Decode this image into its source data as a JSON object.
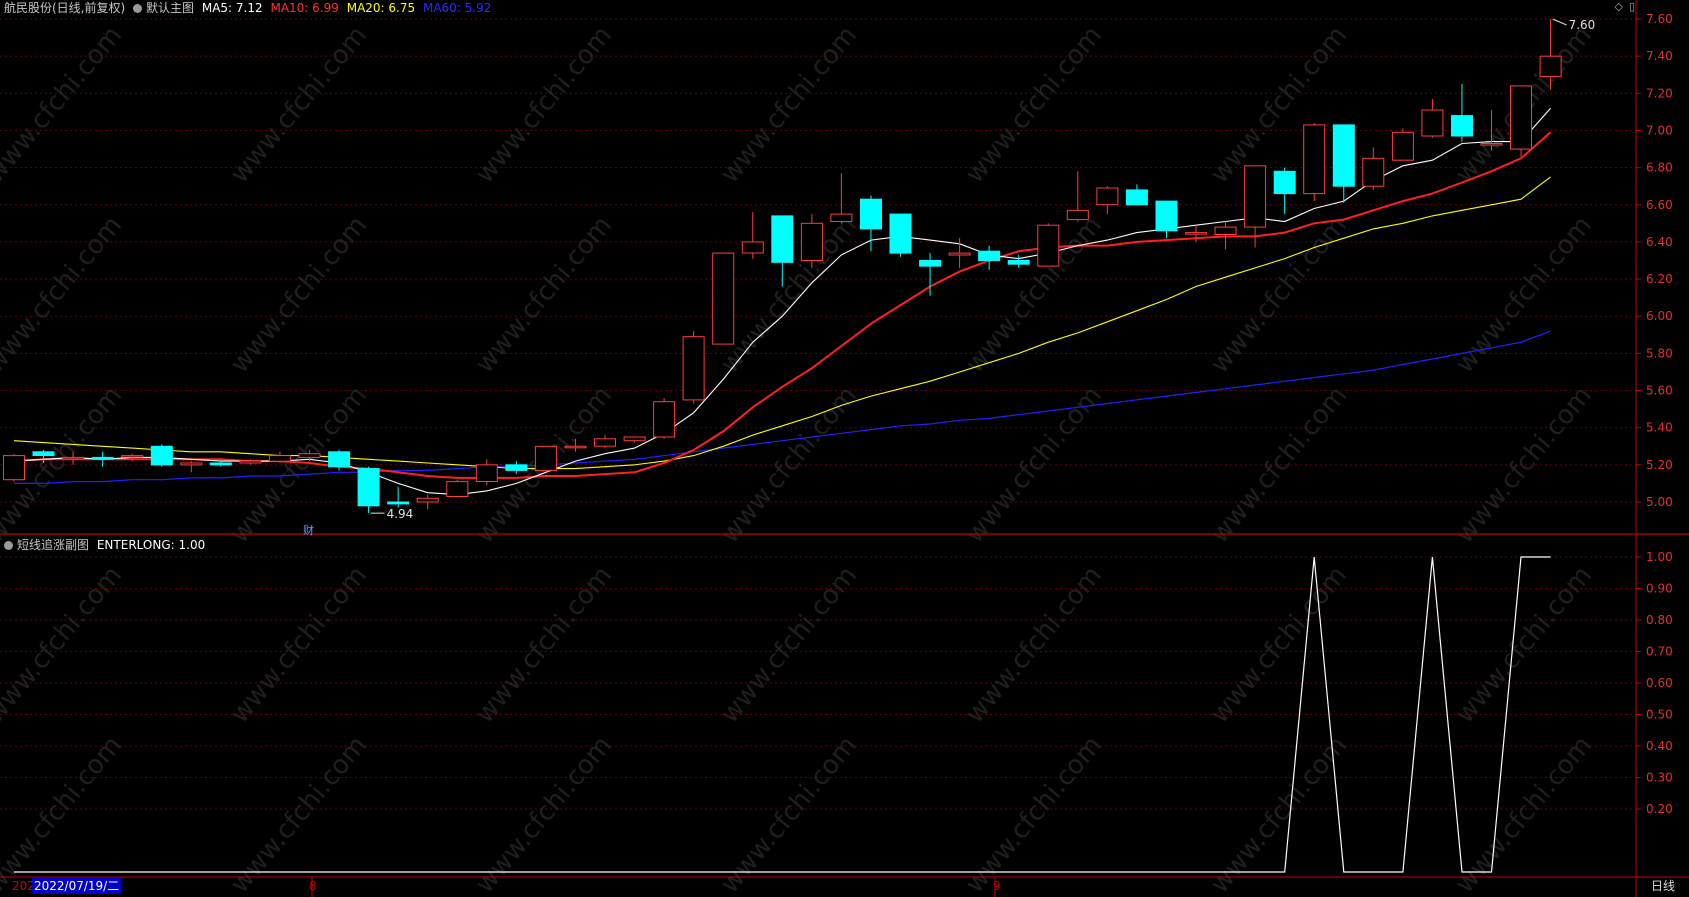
{
  "header": {
    "stock_name": "航民股份(日线,前复权)",
    "main_indicator": "默认主图",
    "ma5": "MA5: 7.12",
    "ma10": "MA10: 6.99",
    "ma20": "MA20: 6.75",
    "ma60": "MA60: 5.92",
    "ma_colors": {
      "ma5": "#ffffff",
      "ma10": "#ff2020",
      "ma20": "#ffff00",
      "ma60": "#2020ff"
    }
  },
  "sub_header": {
    "name": "短线追涨副图",
    "value": "ENTERLONG: 1.00"
  },
  "corner_icons": [
    "diamond-icon",
    "window-icon"
  ],
  "x_axis": {
    "year_stub": "202",
    "date_badge": "2022/07/19/二",
    "tick_8": "8",
    "tick_9": "9"
  },
  "period_label": "日线",
  "annotations": {
    "high_label": "7.60",
    "low_label": "4.94",
    "cai_marker": "财"
  },
  "watermark": "www.cfchi.com",
  "chart_data": [
    {
      "type": "candlestick",
      "y_ticks": [
        "7.60",
        "7.40",
        "7.20",
        "7.00",
        "6.80",
        "6.60",
        "6.40",
        "6.20",
        "6.00",
        "5.80",
        "5.60",
        "5.40",
        "5.20",
        "5.00"
      ],
      "ylim": [
        4.8,
        7.72
      ],
      "colors": {
        "up": "#ff3c3c",
        "down": "#00ffff",
        "grid": "#7a0000",
        "axis": "#c00000"
      },
      "candles": [
        {
          "o": 5.12,
          "h": 5.26,
          "l": 5.11,
          "c": 5.25
        },
        {
          "o": 5.27,
          "h": 5.28,
          "l": 5.21,
          "c": 5.25
        },
        {
          "o": 5.24,
          "h": 5.27,
          "l": 5.2,
          "c": 5.24
        },
        {
          "o": 5.24,
          "h": 5.27,
          "l": 5.19,
          "c": 5.23
        },
        {
          "o": 5.25,
          "h": 5.26,
          "l": 5.22,
          "c": 5.25
        },
        {
          "o": 5.3,
          "h": 5.31,
          "l": 5.19,
          "c": 5.2
        },
        {
          "o": 5.2,
          "h": 5.22,
          "l": 5.16,
          "c": 5.21
        },
        {
          "o": 5.21,
          "h": 5.22,
          "l": 5.19,
          "c": 5.2
        },
        {
          "o": 5.21,
          "h": 5.23,
          "l": 5.2,
          "c": 5.22
        },
        {
          "o": 5.22,
          "h": 5.27,
          "l": 5.21,
          "c": 5.25
        },
        {
          "o": 5.24,
          "h": 5.28,
          "l": 5.22,
          "c": 5.26
        },
        {
          "o": 5.27,
          "h": 5.28,
          "l": 5.17,
          "c": 5.19
        },
        {
          "o": 5.18,
          "h": 5.19,
          "l": 4.94,
          "c": 4.98
        },
        {
          "o": 5.0,
          "h": 5.08,
          "l": 4.97,
          "c": 4.99
        },
        {
          "o": 5.0,
          "h": 5.04,
          "l": 4.96,
          "c": 5.02
        },
        {
          "o": 5.03,
          "h": 5.12,
          "l": 5.03,
          "c": 5.11
        },
        {
          "o": 5.11,
          "h": 5.23,
          "l": 5.09,
          "c": 5.2
        },
        {
          "o": 5.2,
          "h": 5.22,
          "l": 5.15,
          "c": 5.17
        },
        {
          "o": 5.17,
          "h": 5.3,
          "l": 5.16,
          "c": 5.3
        },
        {
          "o": 5.3,
          "h": 5.34,
          "l": 5.27,
          "c": 5.3
        },
        {
          "o": 5.3,
          "h": 5.36,
          "l": 5.29,
          "c": 5.34
        },
        {
          "o": 5.33,
          "h": 5.35,
          "l": 5.32,
          "c": 5.35
        },
        {
          "o": 5.35,
          "h": 5.56,
          "l": 5.34,
          "c": 5.54
        },
        {
          "o": 5.55,
          "h": 5.92,
          "l": 5.53,
          "c": 5.89
        },
        {
          "o": 5.85,
          "h": 6.34,
          "l": 5.85,
          "c": 6.34
        },
        {
          "o": 6.34,
          "h": 6.56,
          "l": 6.31,
          "c": 6.4
        },
        {
          "o": 6.54,
          "h": 6.54,
          "l": 6.16,
          "c": 6.29
        },
        {
          "o": 6.3,
          "h": 6.55,
          "l": 6.26,
          "c": 6.5
        },
        {
          "o": 6.51,
          "h": 6.77,
          "l": 6.5,
          "c": 6.55
        },
        {
          "o": 6.63,
          "h": 6.65,
          "l": 6.35,
          "c": 6.47
        },
        {
          "o": 6.55,
          "h": 6.55,
          "l": 6.32,
          "c": 6.34
        },
        {
          "o": 6.3,
          "h": 6.34,
          "l": 6.11,
          "c": 6.27
        },
        {
          "o": 6.33,
          "h": 6.42,
          "l": 6.26,
          "c": 6.34
        },
        {
          "o": 6.35,
          "h": 6.38,
          "l": 6.25,
          "c": 6.3
        },
        {
          "o": 6.3,
          "h": 6.33,
          "l": 6.26,
          "c": 6.28
        },
        {
          "o": 6.27,
          "h": 6.5,
          "l": 6.27,
          "c": 6.49
        },
        {
          "o": 6.52,
          "h": 6.78,
          "l": 6.51,
          "c": 6.57
        },
        {
          "o": 6.6,
          "h": 6.7,
          "l": 6.55,
          "c": 6.69
        },
        {
          "o": 6.68,
          "h": 6.71,
          "l": 6.6,
          "c": 6.6
        },
        {
          "o": 6.62,
          "h": 6.62,
          "l": 6.42,
          "c": 6.46
        },
        {
          "o": 6.45,
          "h": 6.49,
          "l": 6.4,
          "c": 6.45
        },
        {
          "o": 6.44,
          "h": 6.51,
          "l": 6.36,
          "c": 6.48
        },
        {
          "o": 6.48,
          "h": 6.81,
          "l": 6.37,
          "c": 6.81
        },
        {
          "o": 6.78,
          "h": 6.8,
          "l": 6.55,
          "c": 6.66
        },
        {
          "o": 6.66,
          "h": 7.04,
          "l": 6.62,
          "c": 7.03
        },
        {
          "o": 7.03,
          "h": 7.03,
          "l": 6.61,
          "c": 6.7
        },
        {
          "o": 6.7,
          "h": 6.91,
          "l": 6.68,
          "c": 6.85
        },
        {
          "o": 6.84,
          "h": 7.01,
          "l": 6.84,
          "c": 6.99
        },
        {
          "o": 6.97,
          "h": 7.17,
          "l": 6.96,
          "c": 7.11
        },
        {
          "o": 7.08,
          "h": 7.25,
          "l": 6.94,
          "c": 6.97
        },
        {
          "o": 6.93,
          "h": 7.11,
          "l": 6.89,
          "c": 6.93
        },
        {
          "o": 6.9,
          "h": 7.24,
          "l": 6.86,
          "c": 7.24
        },
        {
          "o": 7.29,
          "h": 7.6,
          "l": 7.22,
          "c": 7.4
        }
      ],
      "ma5": [
        5.22,
        5.23,
        5.24,
        5.23,
        5.24,
        5.24,
        5.23,
        5.22,
        5.22,
        5.22,
        5.23,
        5.21,
        5.16,
        5.1,
        5.05,
        5.04,
        5.06,
        5.1,
        5.16,
        5.22,
        5.26,
        5.29,
        5.37,
        5.48,
        5.66,
        5.86,
        6.0,
        6.18,
        6.33,
        6.41,
        6.43,
        6.41,
        6.39,
        6.33,
        6.31,
        6.34,
        6.38,
        6.41,
        6.45,
        6.47,
        6.49,
        6.51,
        6.53,
        6.51,
        6.58,
        6.62,
        6.73,
        6.81,
        6.84,
        6.93,
        6.94,
        6.94,
        7.12
      ],
      "ma10": [
        5.22,
        5.23,
        5.23,
        5.23,
        5.23,
        5.23,
        5.23,
        5.23,
        5.22,
        5.22,
        5.21,
        5.19,
        5.18,
        5.16,
        5.14,
        5.13,
        5.13,
        5.13,
        5.14,
        5.14,
        5.15,
        5.16,
        5.21,
        5.28,
        5.38,
        5.51,
        5.62,
        5.72,
        5.84,
        5.96,
        6.06,
        6.16,
        6.24,
        6.3,
        6.35,
        6.37,
        6.38,
        6.38,
        6.4,
        6.41,
        6.42,
        6.43,
        6.43,
        6.45,
        6.5,
        6.52,
        6.57,
        6.62,
        6.66,
        6.72,
        6.78,
        6.85,
        6.99
      ],
      "ma20": [
        5.33,
        5.32,
        5.31,
        5.3,
        5.29,
        5.28,
        5.27,
        5.27,
        5.26,
        5.25,
        5.25,
        5.24,
        5.23,
        5.22,
        5.21,
        5.2,
        5.19,
        5.18,
        5.18,
        5.18,
        5.19,
        5.2,
        5.22,
        5.25,
        5.3,
        5.36,
        5.41,
        5.46,
        5.52,
        5.57,
        5.61,
        5.65,
        5.7,
        5.75,
        5.8,
        5.86,
        5.91,
        5.97,
        6.03,
        6.09,
        6.16,
        6.21,
        6.26,
        6.31,
        6.37,
        6.42,
        6.47,
        6.5,
        6.54,
        6.57,
        6.6,
        6.63,
        6.75
      ],
      "ma60": [
        5.1,
        5.1,
        5.11,
        5.11,
        5.12,
        5.12,
        5.13,
        5.13,
        5.14,
        5.14,
        5.15,
        5.16,
        5.16,
        5.17,
        5.17,
        5.18,
        5.19,
        5.19,
        5.2,
        5.21,
        5.22,
        5.23,
        5.25,
        5.27,
        5.29,
        5.31,
        5.33,
        5.35,
        5.37,
        5.39,
        5.41,
        5.42,
        5.44,
        5.45,
        5.47,
        5.49,
        5.51,
        5.53,
        5.55,
        5.57,
        5.59,
        5.61,
        5.63,
        5.65,
        5.67,
        5.69,
        5.71,
        5.74,
        5.77,
        5.8,
        5.83,
        5.86,
        5.92
      ]
    },
    {
      "type": "line",
      "y_ticks": [
        "1.00",
        "0.90",
        "0.80",
        "0.70",
        "0.60",
        "0.50",
        "0.40",
        "0.30",
        "0.20"
      ],
      "ylim": [
        0,
        1.0
      ],
      "series": [
        {
          "name": "ENTERLONG",
          "values": [
            0,
            0,
            0,
            0,
            0,
            0,
            0,
            0,
            0,
            0,
            0,
            0,
            0,
            0,
            0,
            0,
            0,
            0,
            0,
            0,
            0,
            0,
            0,
            0,
            0,
            0,
            0,
            0,
            0,
            0,
            0,
            0,
            0,
            0,
            0,
            0,
            0,
            0,
            0,
            0,
            0,
            0,
            0,
            0,
            1,
            0,
            0,
            0,
            1,
            0,
            0,
            1,
            1
          ]
        }
      ]
    }
  ]
}
